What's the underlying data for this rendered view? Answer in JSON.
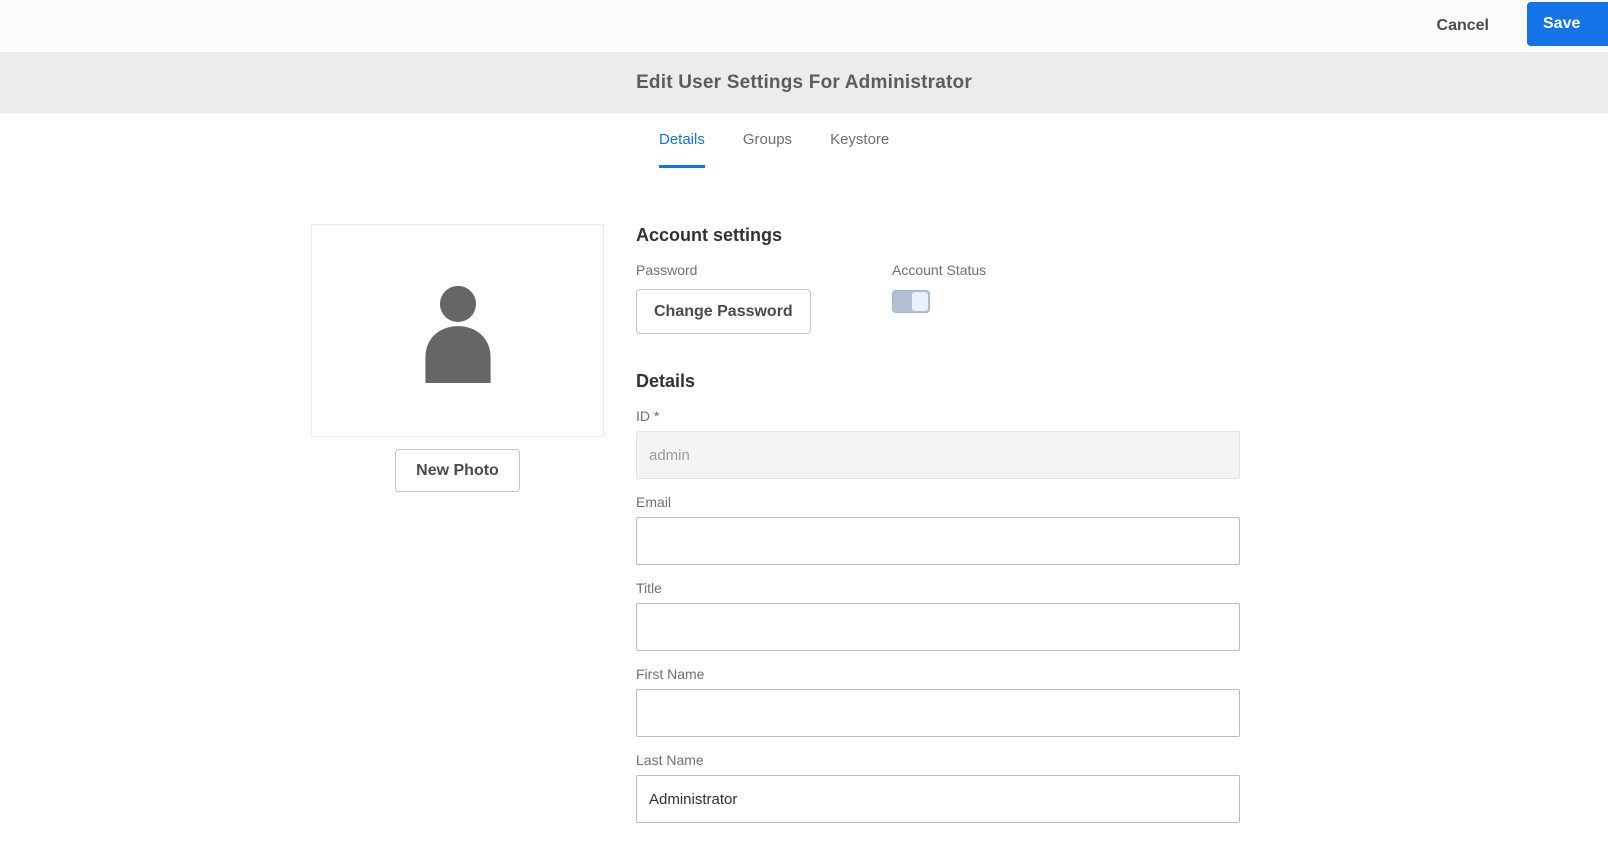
{
  "colors": {
    "accent": "#1473e6",
    "header_bg": "#ececec",
    "button_border": "#c6c6c6",
    "disabled_input_bg": "#f4f4f4"
  },
  "topbar": {
    "cancel_label": "Cancel",
    "save_label": "Save"
  },
  "header": {
    "title": "Edit User Settings For Administrator"
  },
  "tabs": [
    {
      "label": "Details",
      "active": true
    },
    {
      "label": "Groups",
      "active": false
    },
    {
      "label": "Keystore",
      "active": false
    }
  ],
  "photo": {
    "new_photo_label": "New Photo"
  },
  "account": {
    "heading": "Account settings",
    "password_label": "Password",
    "change_password_label": "Change Password",
    "status_label": "Account Status"
  },
  "details": {
    "heading": "Details",
    "fields": [
      {
        "label": "ID *",
        "value": "admin"
      },
      {
        "label": "Email",
        "value": ""
      },
      {
        "label": "Title",
        "value": ""
      },
      {
        "label": "First Name",
        "value": ""
      },
      {
        "label": "Last Name",
        "value": "Administrator"
      }
    ]
  }
}
